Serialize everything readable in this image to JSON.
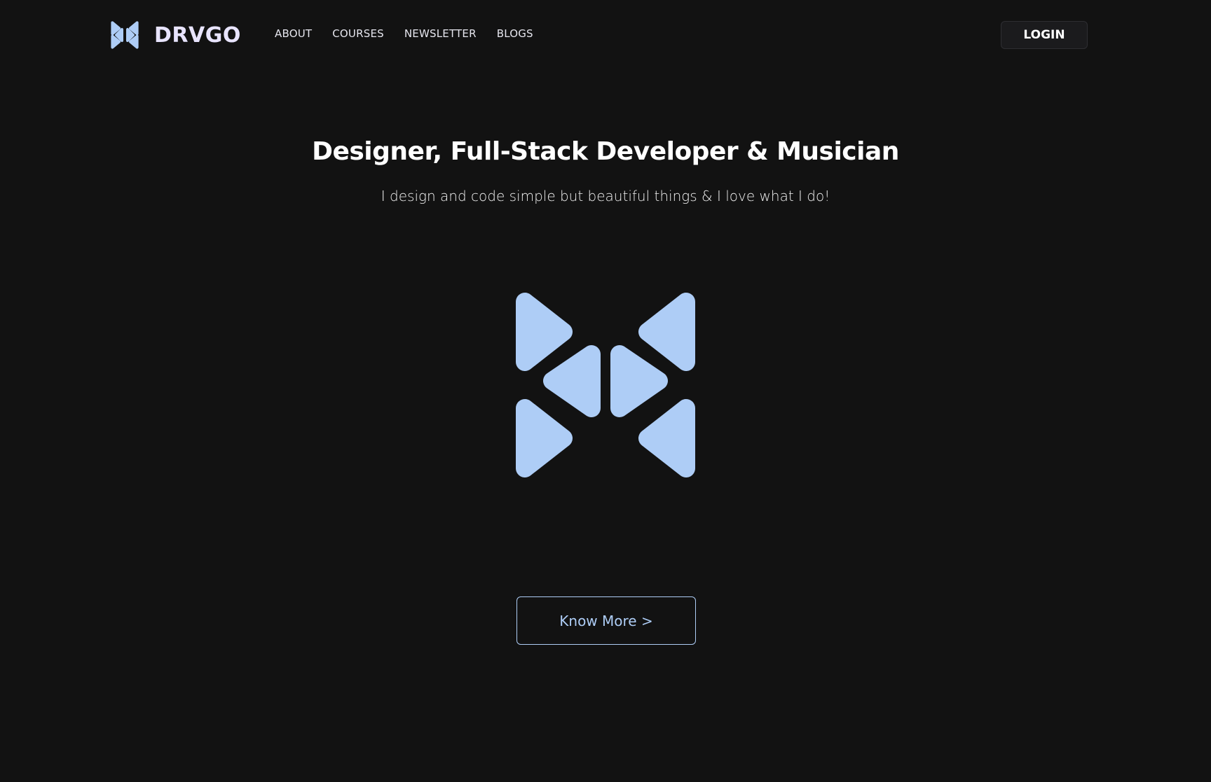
{
  "brand": {
    "name": "DRVGO",
    "logo_icon": "drvgo-logo-icon",
    "color": "#aecdf6"
  },
  "nav": {
    "items": [
      {
        "label": "ABOUT"
      },
      {
        "label": "COURSES"
      },
      {
        "label": "NEWSLETTER"
      },
      {
        "label": "BLOGS"
      }
    ],
    "login_label": "LOGIN"
  },
  "hero": {
    "title": "Designer, Full-Stack Developer & Musician",
    "subtitle": "I design and code simple but beautiful things & I love what I do!",
    "logo_icon": "drvgo-logo-icon",
    "cta_label": "Know More >"
  },
  "colors": {
    "background": "#121212",
    "accent": "#aecdf6",
    "text": "#ffffff"
  }
}
